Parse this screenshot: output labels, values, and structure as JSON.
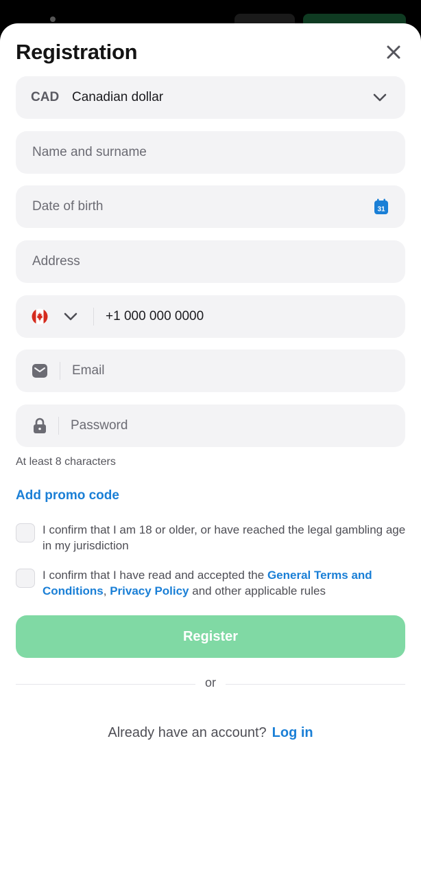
{
  "header": {
    "title": "Registration",
    "close_icon": "close-icon"
  },
  "form": {
    "currency": {
      "code": "CAD",
      "name": "Canadian dollar"
    },
    "name_placeholder": "Name and surname",
    "dob_placeholder": "Date of birth",
    "calendar_day": "31",
    "address_placeholder": "Address",
    "phone": {
      "country": "Canada",
      "prefix": "+1",
      "number_placeholder": "000 000 0000"
    },
    "email_placeholder": "Email",
    "password_placeholder": "Password",
    "password_hint": "At least 8 characters",
    "promo_label": "Add promo code"
  },
  "consents": {
    "age_text": "I confirm that I am 18 or older, or have reached the legal gambling age in my jurisdiction",
    "terms_prefix": "I confirm that I have read and accepted the ",
    "terms_link": "General Terms and Conditions",
    "terms_comma": ", ",
    "privacy_link": "Privacy Policy",
    "terms_suffix": " and other applicable rules"
  },
  "actions": {
    "register_label": "Register",
    "or_label": "or",
    "have_account": "Already have an account?",
    "login_label": "Log in"
  },
  "colors": {
    "accent_blue": "#1a7fd6",
    "register_green": "#80d9a4",
    "field_bg": "#f3f3f5"
  }
}
